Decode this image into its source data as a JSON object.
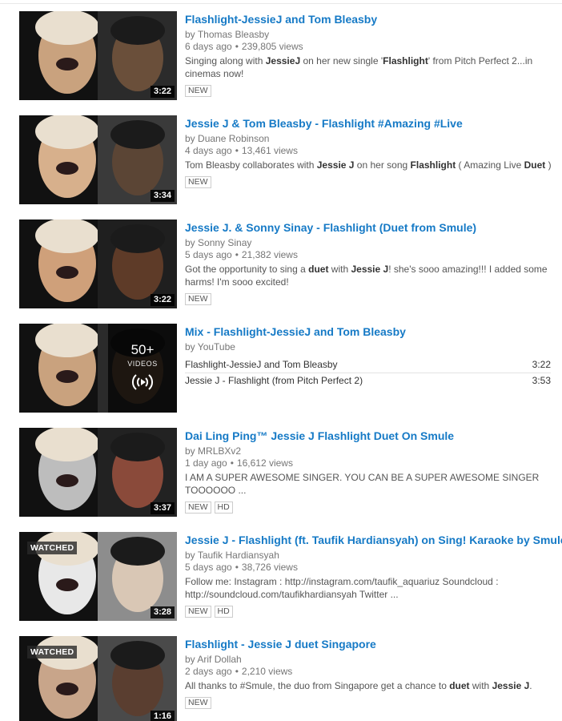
{
  "results": [
    {
      "title": "Flashlight-JessieJ and Tom Bleasby",
      "by_prefix": "by",
      "channel": "Thomas Bleasby",
      "age": "6 days ago",
      "views": "239,805 views",
      "desc_lines": [
        [
          {
            "t": "Singing along with "
          },
          {
            "t": "JessieJ",
            "b": true
          },
          {
            "t": " on her new single '"
          },
          {
            "t": "Flashlight",
            "b": true
          },
          {
            "t": "' from Pitch Perfect 2...in"
          }
        ],
        [
          {
            "t": "cinemas now!"
          }
        ]
      ],
      "badges": [
        "NEW"
      ],
      "duration": "3:22",
      "watched": false
    },
    {
      "title": "Jessie J & Tom Bleasby - Flashlight #Amazing #Live",
      "by_prefix": "by",
      "channel": "Duane Robinson",
      "age": "4 days ago",
      "views": "13,461 views",
      "desc_lines": [
        [
          {
            "t": "Tom Bleasby collaborates with "
          },
          {
            "t": "Jessie J",
            "b": true
          },
          {
            "t": " on her song "
          },
          {
            "t": "Flashlight",
            "b": true
          },
          {
            "t": " ( Amazing Live "
          },
          {
            "t": "Duet",
            "b": true
          },
          {
            "t": " )"
          }
        ]
      ],
      "badges": [
        "NEW"
      ],
      "duration": "3:34",
      "watched": false
    },
    {
      "title": "Jessie J. & Sonny Sinay - Flashlight (Duet from Smule)",
      "by_prefix": "by",
      "channel": "Sonny Sinay",
      "age": "5 days ago",
      "views": "21,382 views",
      "desc_lines": [
        [
          {
            "t": "Got the opportunity to sing a "
          },
          {
            "t": "duet",
            "b": true
          },
          {
            "t": " with "
          },
          {
            "t": "Jessie J",
            "b": true
          },
          {
            "t": "! she's sooo amazing!!! I added some"
          }
        ],
        [
          {
            "t": "harms! I'm sooo excited!"
          }
        ]
      ],
      "badges": [
        "NEW"
      ],
      "duration": "3:22",
      "watched": false
    },
    {
      "title": "Dai Ling Ping™ Jessie J Flashlight Duet On Smule",
      "by_prefix": "by",
      "channel": "MRLBXv2",
      "age": "1 day ago",
      "views": "16,612 views",
      "desc_lines": [
        [
          {
            "t": "I AM A SUPER AWESOME SINGER. YOU CAN BE A SUPER AWESOME SINGER"
          }
        ],
        [
          {
            "t": "TOOOOOO ..."
          }
        ]
      ],
      "badges": [
        "NEW",
        "HD"
      ],
      "duration": "3:37",
      "watched": false
    },
    {
      "title": "Jessie J - Flashlight (ft. Taufik Hardiansyah) on Sing! Karaoke by Smule",
      "by_prefix": "by",
      "channel": "Taufik Hardiansyah",
      "age": "5 days ago",
      "views": "38,726 views",
      "desc_lines": [
        [
          {
            "t": "Follow me: Instagram : http://instagram.com/taufik_aquariuz Soundcloud :"
          }
        ],
        [
          {
            "t": "http://soundcloud.com/taufikhardiansyah Twitter ..."
          }
        ]
      ],
      "badges": [
        "NEW",
        "HD"
      ],
      "duration": "3:28",
      "watched": true,
      "watched_label": "WATCHED"
    },
    {
      "title": "Flashlight - Jessie J duet Singapore",
      "by_prefix": "by",
      "channel": "Arif Dollah",
      "age": "2 days ago",
      "views": "2,210 views",
      "desc_lines": [
        [
          {
            "t": "All thanks to #Smule, the duo from Singapore get a chance to "
          },
          {
            "t": "duet",
            "b": true
          },
          {
            "t": " with "
          },
          {
            "t": "Jessie J",
            "b": true
          },
          {
            "t": "."
          }
        ]
      ],
      "badges": [
        "NEW"
      ],
      "duration": "1:16",
      "watched": true,
      "watched_label": "WATCHED"
    }
  ],
  "mix": {
    "title": "Mix - Flashlight-JessieJ and Tom Bleasby",
    "by": "by YouTube",
    "count": "50+",
    "count_label": "VIDEOS",
    "icon": "mix-broadcast-icon",
    "items": [
      {
        "title": "Flashlight-JessieJ and Tom Bleasby",
        "duration": "3:22"
      },
      {
        "title": "Jessie J - Flashlight (from Pitch Perfect 2)",
        "duration": "3:53"
      }
    ]
  },
  "colors": {
    "link": "#167ac6",
    "meta": "#767676",
    "text": "#555555"
  }
}
